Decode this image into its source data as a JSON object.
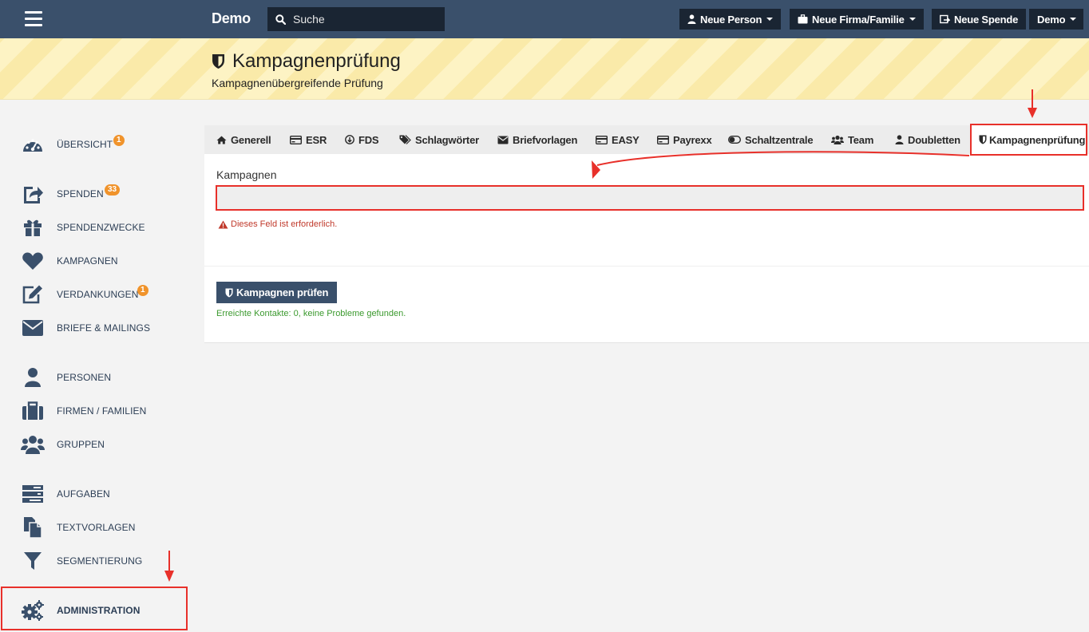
{
  "topbar": {
    "brand": "Demo",
    "search_placeholder": "Suche",
    "btn_new_person": "Neue Person",
    "btn_new_company": "Neue Firma/Familie",
    "btn_new_donation": "Neue Spende",
    "btn_user": "Demo"
  },
  "header": {
    "title": "Kampagnenprüfung",
    "subtitle": "Kampagnenübergreifende Prüfung"
  },
  "sidebar": {
    "items": [
      {
        "label": "ÜBERSICHT",
        "badge": "1",
        "icon": "dashboard-icon"
      },
      {
        "label": "SPENDEN",
        "badge": "33",
        "icon": "share-icon"
      },
      {
        "label": "SPENDENZWECKE",
        "icon": "gift-icon"
      },
      {
        "label": "KAMPAGNEN",
        "icon": "heart-icon"
      },
      {
        "label": "VERDANKUNGEN",
        "badge": "1",
        "icon": "edit-icon"
      },
      {
        "label": "BRIEFE & MAILINGS",
        "icon": "envelope-icon"
      },
      {
        "label": "PERSONEN",
        "icon": "user-icon"
      },
      {
        "label": "FIRMEN / FAMILIEN",
        "icon": "briefcase-icon"
      },
      {
        "label": "GRUPPEN",
        "icon": "users-icon"
      },
      {
        "label": "AUFGABEN",
        "icon": "tasks-icon"
      },
      {
        "label": "TEXTVORLAGEN",
        "icon": "copy-icon"
      },
      {
        "label": "SEGMENTIERUNG",
        "icon": "filter-icon"
      },
      {
        "label": "ADMINISTRATION",
        "icon": "cogs-icon"
      }
    ]
  },
  "tabs": [
    {
      "label": "Generell",
      "icon": "home-icon"
    },
    {
      "label": "ESR",
      "icon": "credit-card-icon"
    },
    {
      "label": "FDS",
      "icon": "arrow-circle-icon"
    },
    {
      "label": "Schlagwörter",
      "icon": "tags-icon"
    },
    {
      "label": "Briefvorlagen",
      "icon": "envelope-icon"
    },
    {
      "label": "EASY",
      "icon": "credit-card-icon"
    },
    {
      "label": "Payrexx",
      "icon": "credit-card-icon"
    },
    {
      "label": "Schaltzentrale",
      "icon": "toggle-icon"
    },
    {
      "label": "Team",
      "icon": "users-icon"
    },
    {
      "label": "Doubletten",
      "icon": "user-icon"
    },
    {
      "label": "Kampagnenprüfung",
      "icon": "shield-icon",
      "active": true
    }
  ],
  "form": {
    "campaigns_label": "Kampagnen",
    "campaigns_value": "",
    "error_text": "Dieses Feld ist erforderlich.",
    "check_button": "Kampagnen prüfen",
    "result_text": "Erreichte Kontakte: 0, keine Probleme gefunden."
  },
  "colors": {
    "topbar": "#3a506b",
    "dark_button": "#1a2533",
    "accent_badge": "#f0932b",
    "error": "#c0392b",
    "success": "#3c9a2f",
    "annotation": "#e8302a"
  }
}
